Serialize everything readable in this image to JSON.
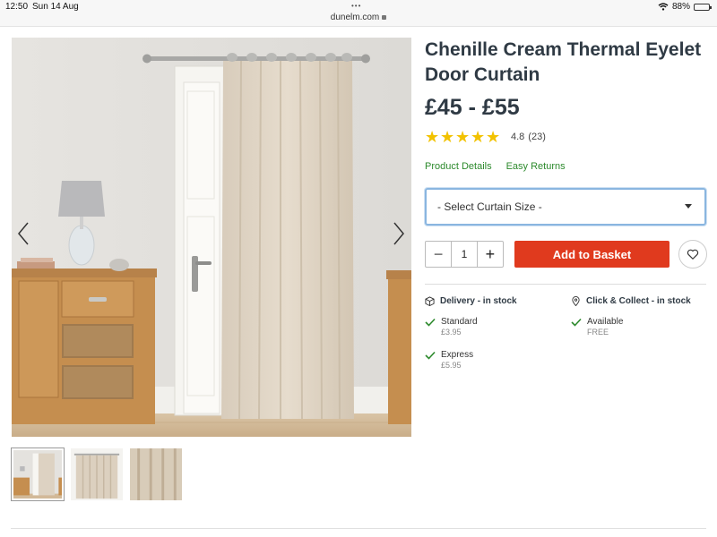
{
  "status_bar": {
    "time": "12:50",
    "date": "Sun 14 Aug",
    "dots": "•••",
    "url": "dunelm.com",
    "battery": "88%",
    "battery_level": 0.88
  },
  "gallery": {
    "active_index": 0,
    "thumbnail_count": 3
  },
  "product": {
    "title": "Chenille Cream Thermal Eyelet Door Curtain",
    "price": "£45 - £55",
    "rating": {
      "stars": 5,
      "value": "4.8",
      "count": "(23)"
    },
    "links": {
      "details": "Product Details",
      "returns": "Easy Returns"
    },
    "size_select": {
      "selected": "- Select Curtain Size -"
    },
    "quantity": {
      "minus": "−",
      "value": "1",
      "plus": "+"
    },
    "add_to_basket": "Add to Basket"
  },
  "delivery": {
    "heading": "Delivery - in stock",
    "options": [
      {
        "name": "Standard",
        "price": "£3.95"
      },
      {
        "name": "Express",
        "price": "£5.95"
      }
    ]
  },
  "click_collect": {
    "heading": "Click & Collect - in stock",
    "options": [
      {
        "name": "Available",
        "price": "FREE"
      }
    ]
  },
  "colors": {
    "accent_green": "#2d8a2d",
    "cta_red": "#e03a1e",
    "star_yellow": "#f2c200",
    "heading": "#2f3a44"
  }
}
